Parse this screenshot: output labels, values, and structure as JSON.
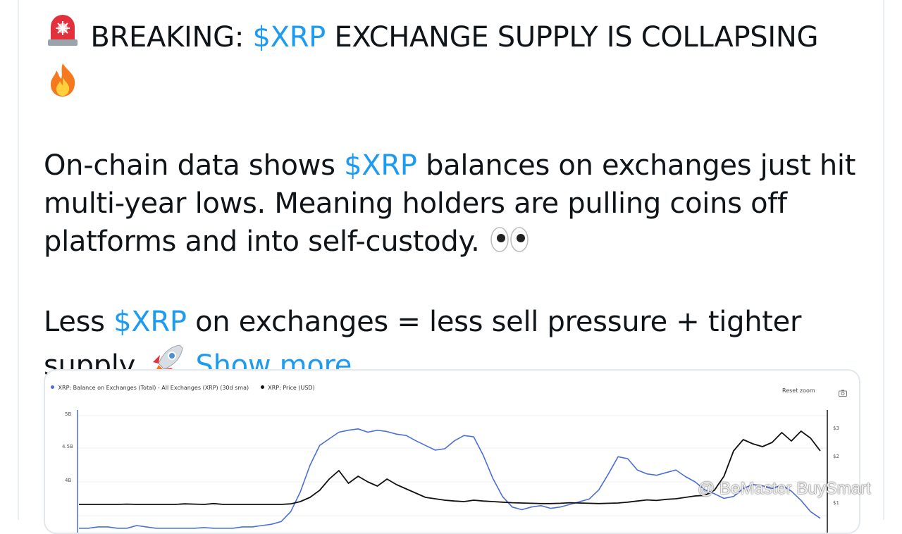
{
  "post": {
    "headline_prefix": "BREAKING:",
    "cashtag": "$XRP",
    "headline_suffix": "EXCHANGE SUPPLY IS COLLAPSING",
    "para1_line1_a": "On-chain data shows",
    "para1_line1_b": "balances on exchanges just hit",
    "para1_line2": "multi-year lows. Meaning holders are pulling coins off",
    "para1_line3": "platforms and into self-custody.",
    "para2_line1_a": "Less",
    "para2_line1_b": "on exchanges = less sell pressure + tighter",
    "para2_line2": "supply.",
    "show_more": "Show more"
  },
  "icons": [
    "siren-emoji",
    "fire-emoji",
    "eyes-emoji",
    "rocket-emoji"
  ],
  "chart_card": {
    "legend": [
      {
        "label": "XRP: Balance on Exchanges (Total) - All Exchanges (XRP) (30d sma)",
        "color": "#4a6fd6"
      },
      {
        "label": "XRP: Price (USD)",
        "color": "#111111"
      }
    ],
    "reset_zoom": "Reset zoom",
    "left_axis_ticks": [
      "5B",
      "4.5B",
      "4B"
    ],
    "right_axis_ticks": [
      "$3",
      "$2",
      "$1"
    ]
  },
  "chart_data": {
    "type": "line",
    "series": [
      {
        "name": "XRP: Balance on Exchanges (Total) - All Exchanges (XRP) (30d sma)",
        "color": "#4a6fd6",
        "values": [
          3.3,
          3.3,
          3.32,
          3.32,
          3.3,
          3.3,
          3.34,
          3.32,
          3.3,
          3.3,
          3.3,
          3.3,
          3.3,
          3.31,
          3.3,
          3.3,
          3.3,
          3.32,
          3.32,
          3.34,
          3.36,
          3.4,
          3.55,
          3.85,
          4.25,
          4.55,
          4.65,
          4.75,
          4.78,
          4.8,
          4.75,
          4.78,
          4.76,
          4.72,
          4.7,
          4.62,
          4.55,
          4.48,
          4.5,
          4.62,
          4.7,
          4.68,
          4.4,
          4.05,
          3.78,
          3.62,
          3.58,
          3.62,
          3.64,
          3.6,
          3.62,
          3.66,
          3.7,
          3.74,
          3.88,
          4.12,
          4.38,
          4.35,
          4.18,
          4.12,
          4.1,
          4.14,
          4.18,
          4.08,
          4.0,
          3.88,
          3.82,
          3.75,
          3.78,
          3.9,
          3.96,
          3.94,
          3.9,
          3.95,
          3.86,
          3.72,
          3.55,
          3.45
        ]
      },
      {
        "name": "XRP: Price (USD)",
        "color": "#111111",
        "values": [
          0.3,
          0.3,
          0.3,
          0.3,
          0.3,
          0.31,
          0.3,
          0.3,
          0.3,
          0.3,
          0.3,
          0.32,
          0.31,
          0.3,
          0.33,
          0.3,
          0.3,
          0.3,
          0.3,
          0.3,
          0.3,
          0.3,
          0.32,
          0.4,
          0.55,
          0.8,
          1.2,
          1.5,
          1.05,
          1.3,
          1.1,
          0.95,
          1.2,
          1.0,
          0.85,
          0.7,
          0.55,
          0.5,
          0.45,
          0.42,
          0.4,
          0.45,
          0.42,
          0.4,
          0.38,
          0.36,
          0.35,
          0.34,
          0.33,
          0.33,
          0.34,
          0.36,
          0.35,
          0.34,
          0.33,
          0.34,
          0.35,
          0.38,
          0.42,
          0.46,
          0.44,
          0.48,
          0.5,
          0.55,
          0.6,
          0.62,
          0.8,
          1.3,
          2.2,
          2.6,
          2.45,
          2.35,
          2.5,
          2.85,
          2.55,
          2.9,
          2.65,
          2.2
        ]
      }
    ],
    "left_axis_ticks": [
      "5B",
      "4.5B",
      "4B"
    ],
    "right_axis_ticks": [
      "$3",
      "$2",
      "$1"
    ],
    "grid": true,
    "legend_placement": "top-left"
  },
  "watermark": "@ BeMaster BuySmart"
}
